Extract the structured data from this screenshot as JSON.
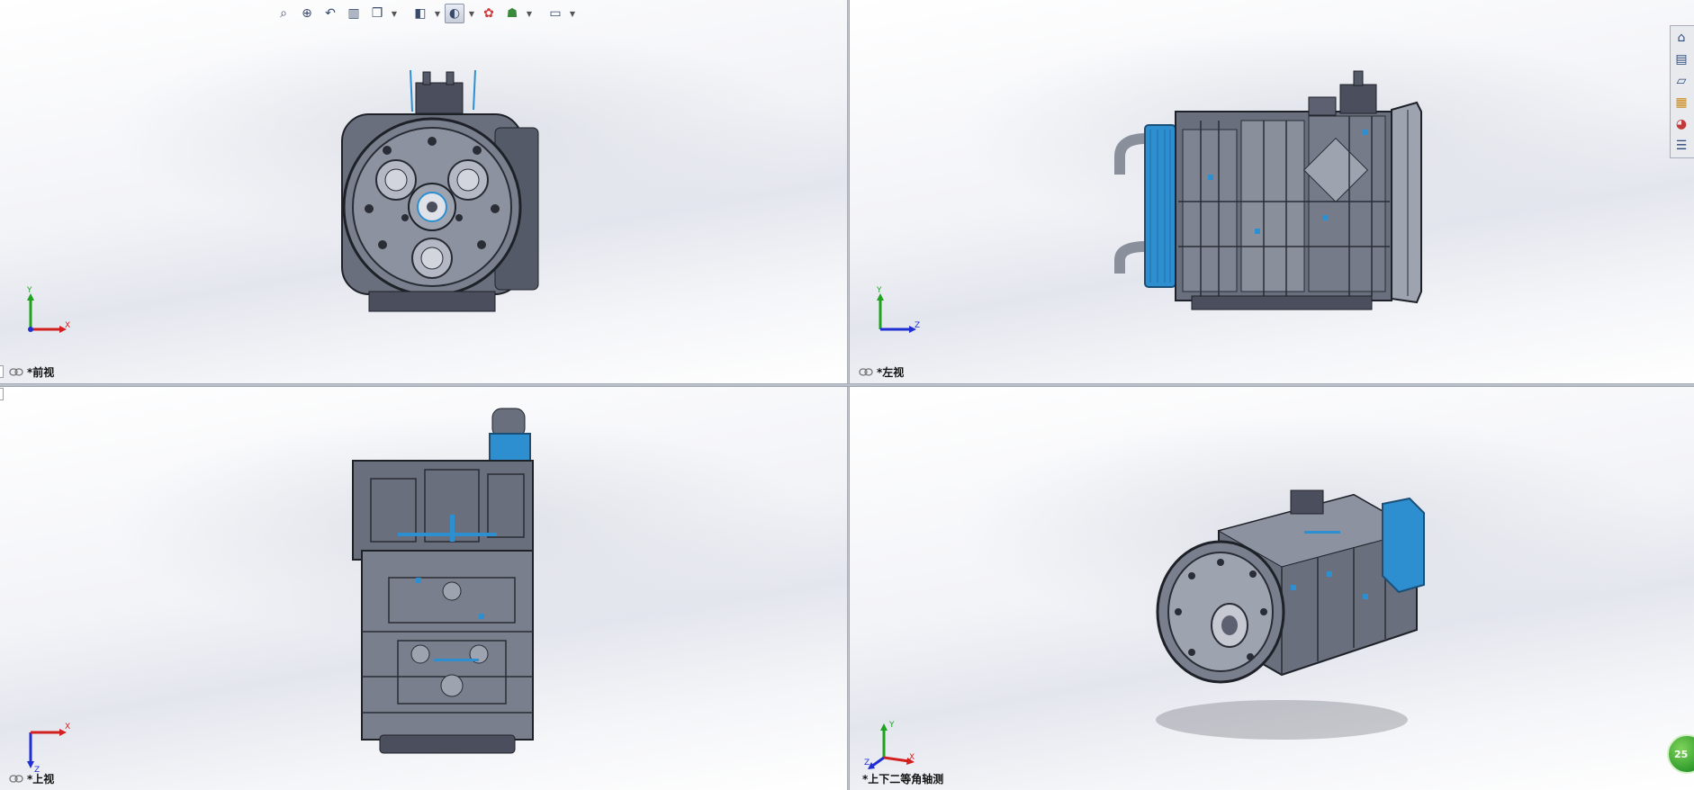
{
  "views": {
    "front": {
      "label": "*前视",
      "axes": {
        "vertical": "Y",
        "horizontal": "X"
      }
    },
    "left": {
      "label": "*左视",
      "axes": {
        "vertical": "Y",
        "horizontal": "Z"
      }
    },
    "top": {
      "label": "*上视",
      "axes": {
        "vertical": "Z",
        "horizontal": "X"
      }
    },
    "iso": {
      "label": "*上下二等角轴测",
      "axes": {
        "vertical": "Y",
        "horizontal": "X",
        "depth": "Z"
      }
    }
  },
  "hud_toolbar": {
    "buttons": [
      {
        "name": "zoom-to-fit-icon"
      },
      {
        "name": "zoom-to-area-icon"
      },
      {
        "name": "previous-view-icon"
      },
      {
        "name": "section-view-icon"
      },
      {
        "name": "view-orientation-icon"
      },
      {
        "name": "display-style-icon"
      },
      {
        "name": "hide-show-items-icon"
      },
      {
        "name": "edit-appearance-icon"
      },
      {
        "name": "apply-scene-icon"
      },
      {
        "name": "view-settings-icon"
      }
    ]
  },
  "task_pane": {
    "tabs": [
      {
        "name": "solidworks-resources-icon"
      },
      {
        "name": "design-library-icon"
      },
      {
        "name": "file-explorer-icon"
      },
      {
        "name": "view-palette-icon"
      },
      {
        "name": "appearances-icon"
      },
      {
        "name": "custom-properties-icon"
      }
    ]
  },
  "perf_badge": {
    "text": "25"
  },
  "colors": {
    "metal": "#5c6070",
    "metal_light": "#a9adba",
    "accent_blue": "#2e8fd0",
    "axis_x": "#d21f1f",
    "axis_y": "#1fa31f",
    "axis_z": "#1f2fd2"
  }
}
